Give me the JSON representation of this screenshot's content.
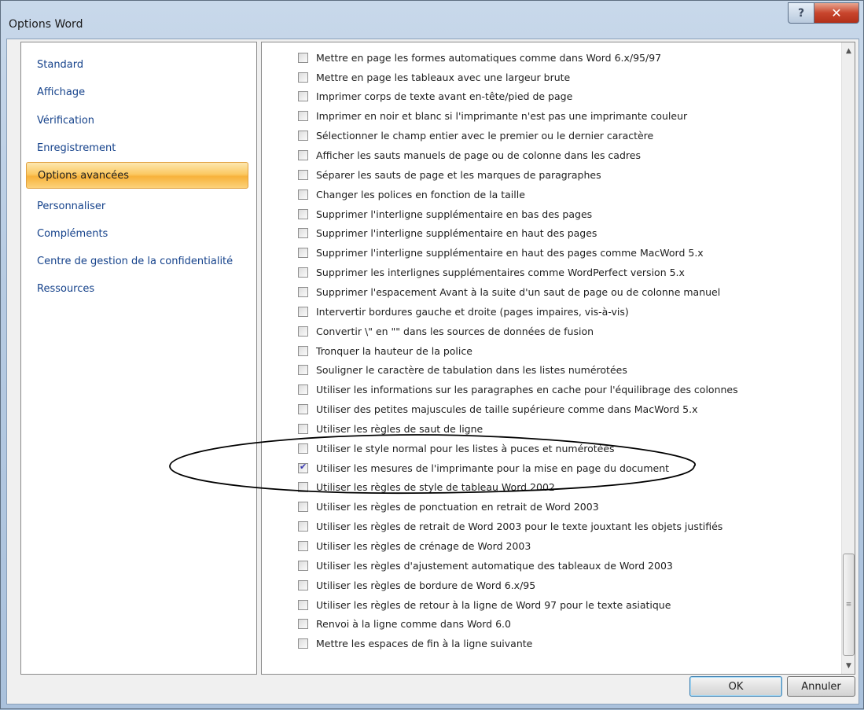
{
  "window": {
    "title": "Options Word",
    "help_glyph": "?",
    "close_glyph": "✕"
  },
  "nav": {
    "items": [
      {
        "label": "Standard"
      },
      {
        "label": "Affichage"
      },
      {
        "label": "Vérification"
      },
      {
        "label": "Enregistrement"
      },
      {
        "label": "Options avancées",
        "selected": true
      },
      {
        "label": "Personnaliser"
      },
      {
        "label": "Compléments"
      },
      {
        "label": "Centre de gestion de la confidentialité"
      },
      {
        "label": "Ressources"
      }
    ]
  },
  "options": [
    {
      "label": "Mettre en page les formes automatiques comme dans Word 6.x/95/97",
      "checked": false
    },
    {
      "label": "Mettre en page les tableaux avec une largeur brute",
      "checked": false
    },
    {
      "label": "Imprimer corps de texte avant en-tête/pied de page",
      "checked": false
    },
    {
      "label": "Imprimer en noir et blanc si l'imprimante n'est pas une imprimante couleur",
      "checked": false
    },
    {
      "label": "Sélectionner le champ entier avec le premier ou le dernier caractère",
      "checked": false
    },
    {
      "label": "Afficher les sauts manuels de page ou de colonne dans les cadres",
      "checked": false
    },
    {
      "label": "Séparer les sauts de page et les marques de paragraphes",
      "checked": false
    },
    {
      "label": "Changer les polices en fonction de la taille",
      "checked": false
    },
    {
      "label": "Supprimer l'interligne supplémentaire en bas des pages",
      "checked": false
    },
    {
      "label": "Supprimer l'interligne supplémentaire en haut des pages",
      "checked": false
    },
    {
      "label": "Supprimer l'interligne supplémentaire en haut des pages comme MacWord 5.x",
      "checked": false
    },
    {
      "label": "Supprimer les interlignes supplémentaires comme WordPerfect version 5.x",
      "checked": false
    },
    {
      "label": "Supprimer l'espacement Avant à la suite d'un saut de page ou de colonne manuel",
      "checked": false
    },
    {
      "label": "Intervertir bordures gauche et droite (pages impaires, vis-à-vis)",
      "checked": false
    },
    {
      "label": "Convertir \\\" en \"\" dans les sources de données de fusion",
      "checked": false
    },
    {
      "label": "Tronquer la hauteur de la police",
      "checked": false
    },
    {
      "label": "Souligner le caractère de tabulation dans les listes numérotées",
      "checked": false
    },
    {
      "label": "Utiliser les informations sur les paragraphes en cache pour l'équilibrage des colonnes",
      "checked": false
    },
    {
      "label": "Utiliser des petites majuscules de taille supérieure comme dans MacWord 5.x",
      "checked": false
    },
    {
      "label": "Utiliser les règles de saut de ligne",
      "checked": false
    },
    {
      "label": "Utiliser le style normal pour les listes à puces et numérotées",
      "checked": false
    },
    {
      "label": "Utiliser les mesures de l'imprimante pour la mise en page du document",
      "checked": true
    },
    {
      "label": "Utiliser les règles de style de tableau Word 2002",
      "checked": false
    },
    {
      "label": "Utiliser les règles de ponctuation en retrait de Word 2003",
      "checked": false
    },
    {
      "label": "Utiliser les règles de retrait de Word 2003 pour le texte jouxtant les objets justifiés",
      "checked": false
    },
    {
      "label": "Utiliser les règles de crénage de Word 2003",
      "checked": false
    },
    {
      "label": "Utiliser les règles d'ajustement automatique des tableaux de Word 2003",
      "checked": false
    },
    {
      "label": "Utiliser les règles de bordure de Word 6.x/95",
      "checked": false
    },
    {
      "label": "Utiliser les règles de retour à la ligne de Word 97 pour le texte asiatique",
      "checked": false
    },
    {
      "label": "Renvoi à la ligne comme dans Word 6.0",
      "checked": false
    },
    {
      "label": "Mettre les espaces de fin à la ligne suivante",
      "checked": false
    }
  ],
  "scrollbar": {
    "up_glyph": "▲",
    "down_glyph": "▼",
    "grip_glyph": "≡"
  },
  "buttons": {
    "ok": "OK",
    "cancel": "Annuler"
  }
}
